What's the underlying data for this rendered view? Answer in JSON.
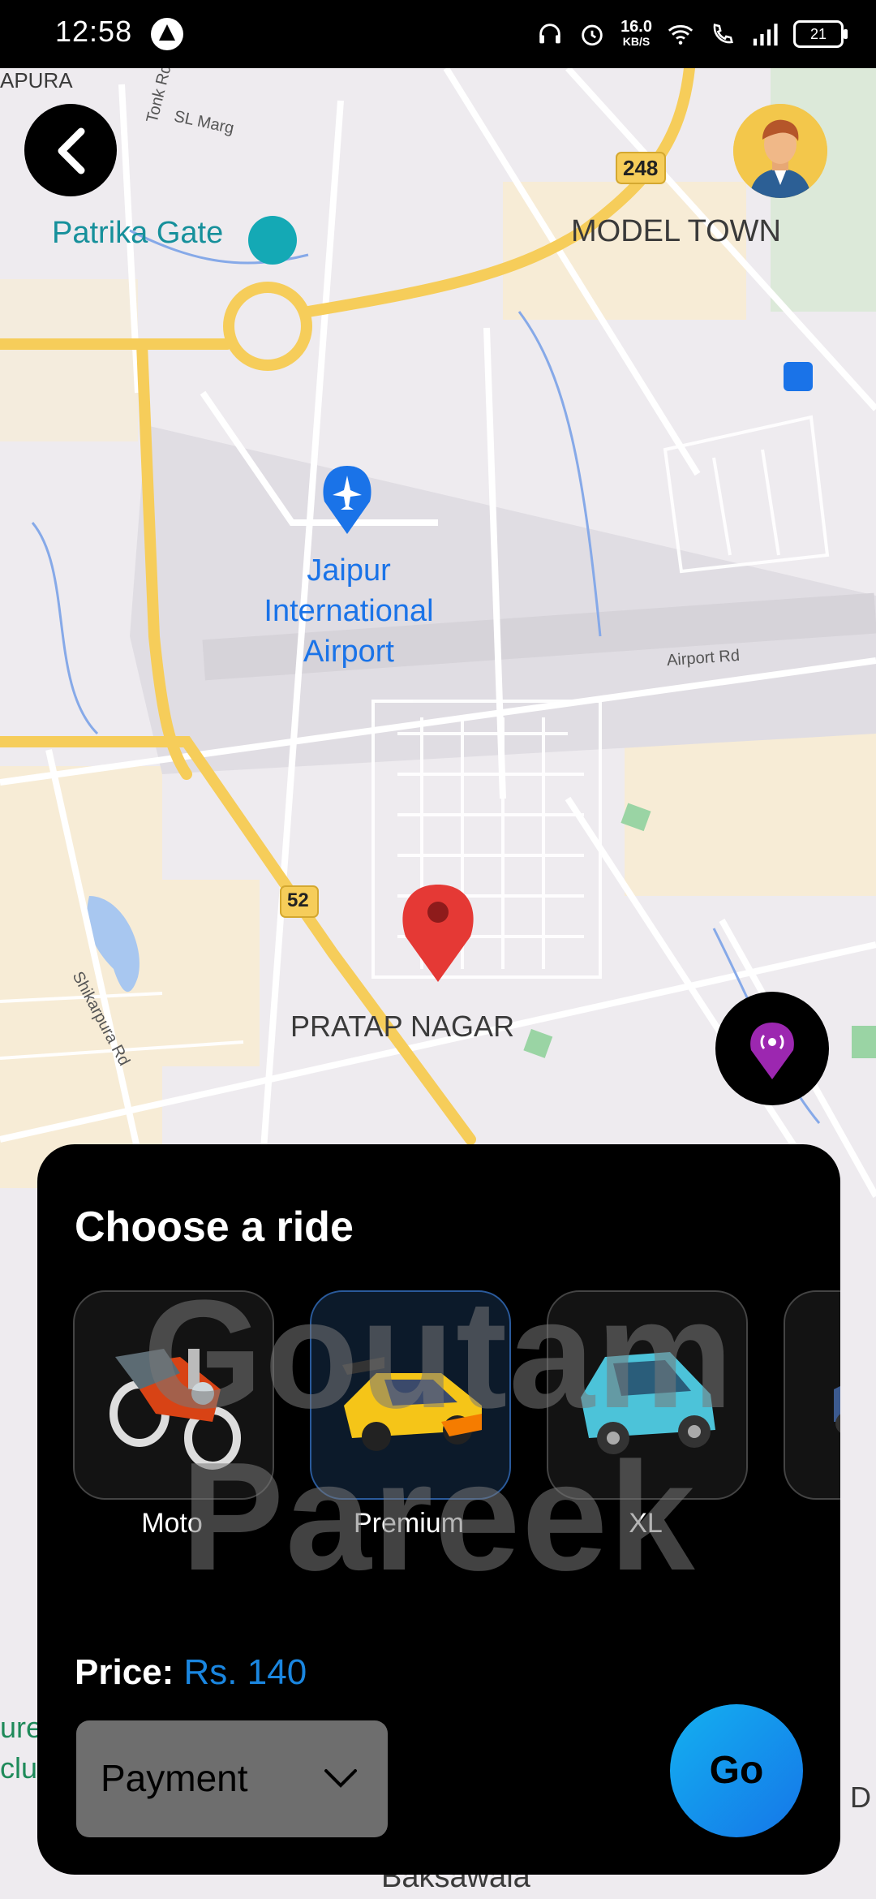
{
  "status_bar": {
    "time": "12:58",
    "net_speed": "16.0",
    "net_unit": "KB/S",
    "battery": "21"
  },
  "map": {
    "labels": {
      "apura": "APURA",
      "tonk_rd": "Tonk Rd",
      "sl_marg": "SL Marg",
      "patrika_gate": "Patrika Gate",
      "model_town": "MODEL TOWN",
      "route_248": "248",
      "airport_name_1": "Jaipur",
      "airport_name_2": "International",
      "airport_name_3": "Airport",
      "airport_rd": "Airport Rd",
      "route_52": "52",
      "shikarpura_rd": "Shikarpura Rd",
      "pratap_nagar": "PRATAP NAGAR",
      "baksawala": "Baksawala",
      "left_ure": "ure",
      "left_clu": "clu",
      "right_d": "l D"
    }
  },
  "panel": {
    "title": "Choose a ride",
    "rides": [
      {
        "label": "Moto",
        "selected": false
      },
      {
        "label": "Premium",
        "selected": true
      },
      {
        "label": "XL",
        "selected": false
      }
    ],
    "price_label": "Price:",
    "price_value": "Rs. 140",
    "payment_label": "Payment",
    "go_label": "Go",
    "watermark_line1": "Goutam",
    "watermark_line2": "Pareek"
  },
  "colors": {
    "accent_blue": "#1a86e0",
    "road_yellow": "#f6cd5a",
    "panel_bg": "#000000"
  }
}
